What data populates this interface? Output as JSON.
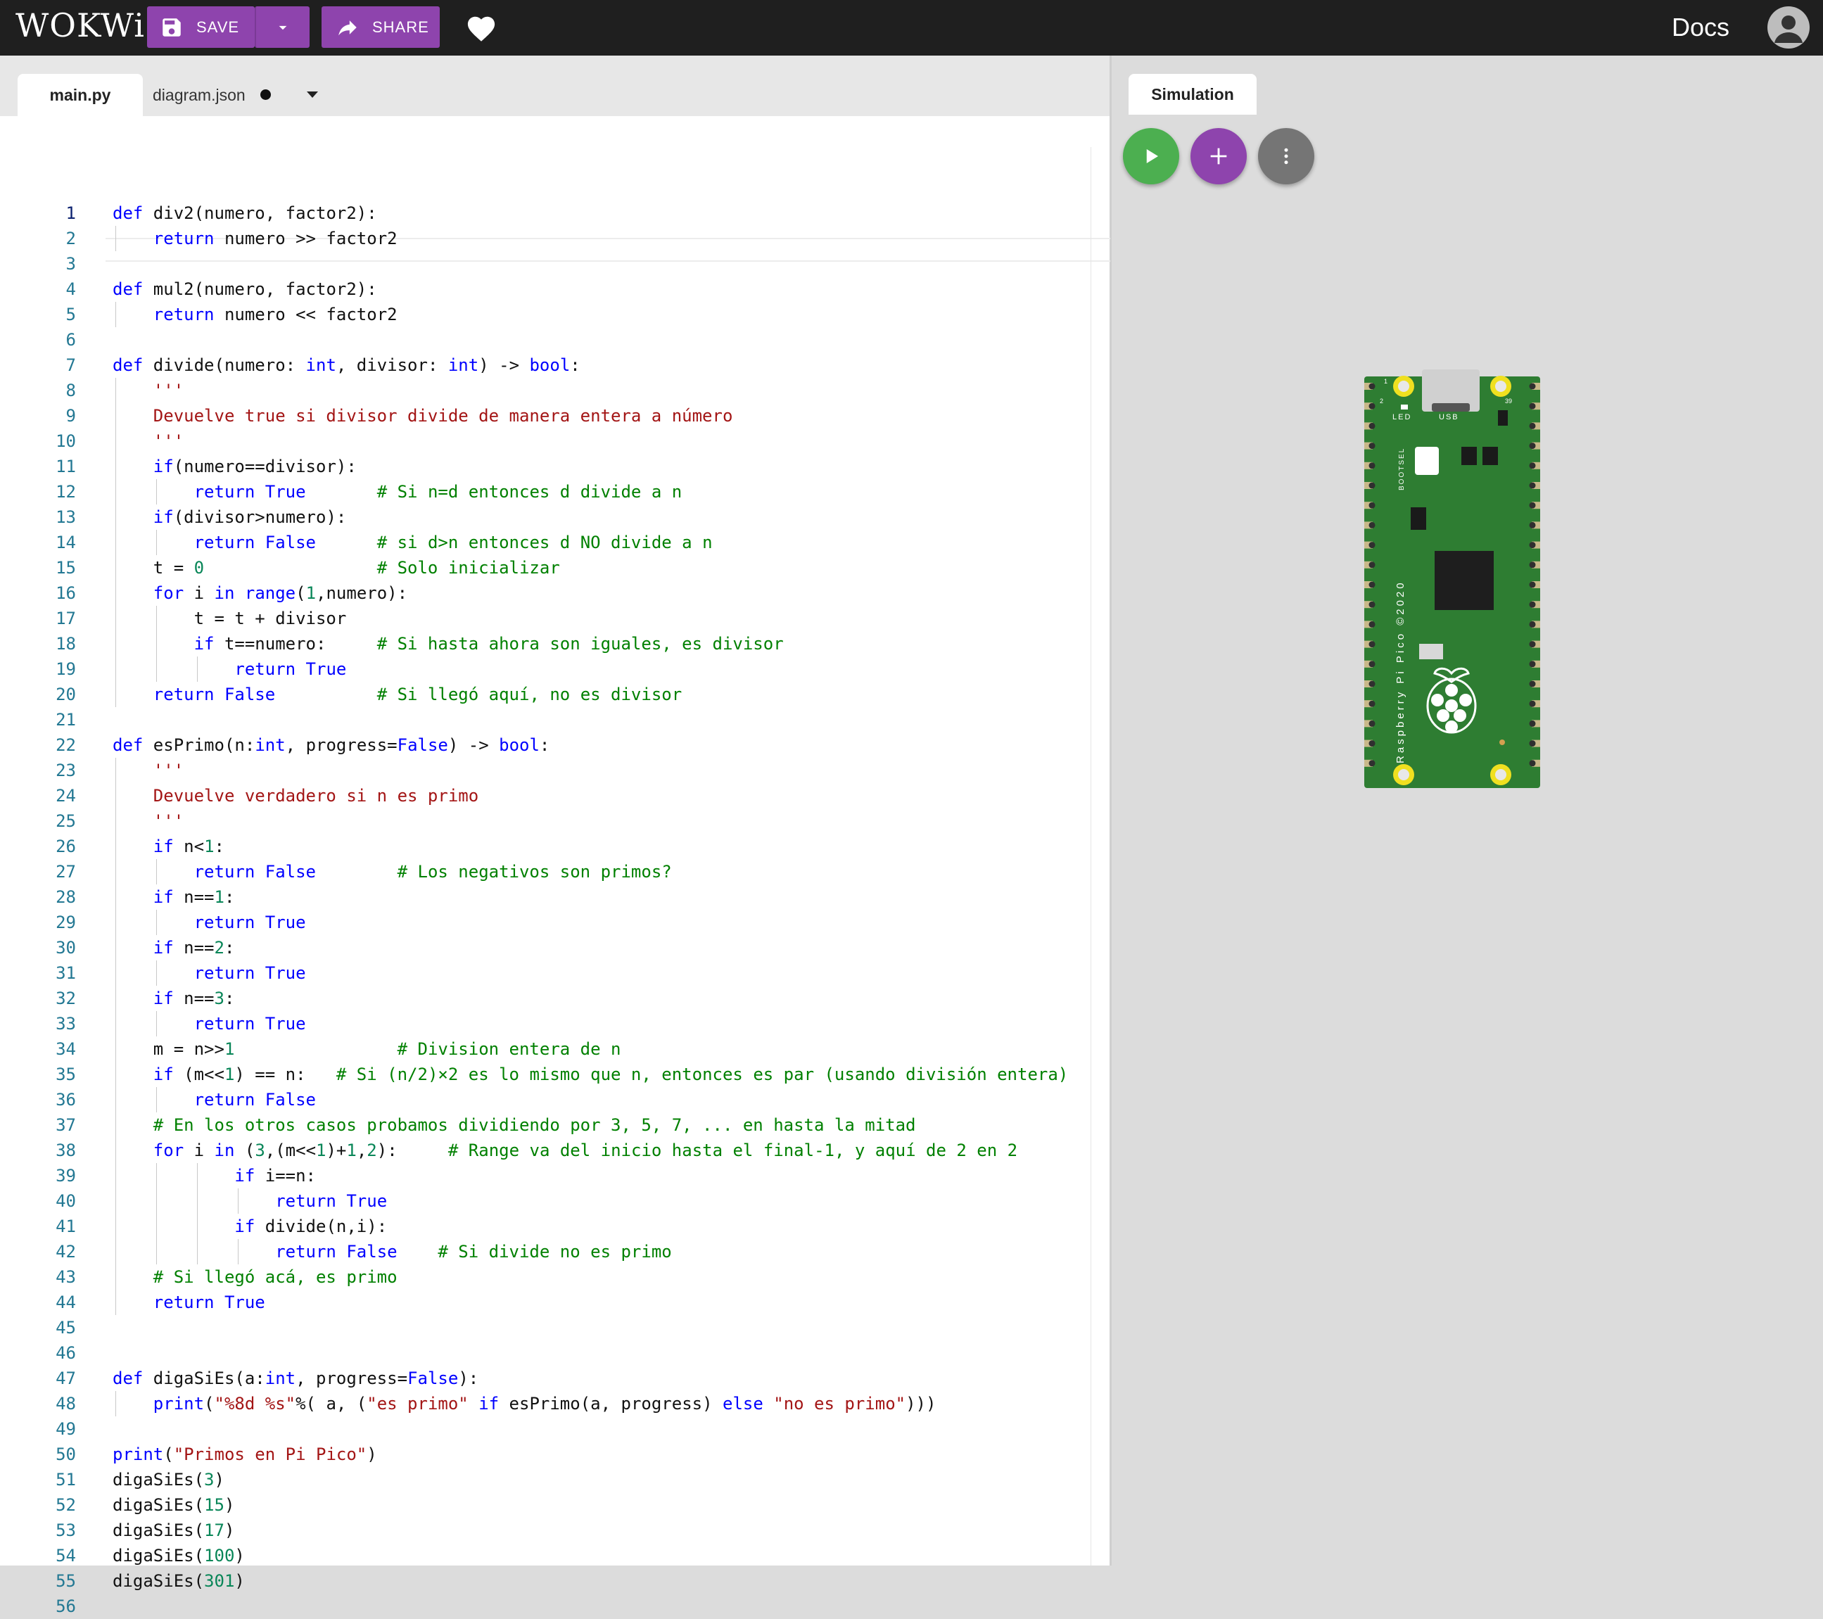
{
  "header": {
    "logo": "WOKWi",
    "save_label": "SAVE",
    "share_label": "SHARE",
    "docs_label": "Docs",
    "icons": [
      "save-icon",
      "chevron-down-icon",
      "share-icon",
      "heart-icon",
      "avatar-icon"
    ]
  },
  "editor": {
    "tabs": [
      {
        "label": "main.py",
        "active": true
      },
      {
        "label": "diagram.json",
        "modified": true
      }
    ]
  },
  "code": [
    "def div2(numero, factor2):",
    "    return numero >> factor2",
    "",
    "def mul2(numero, factor2):",
    "    return numero << factor2",
    "",
    "def divide(numero: int, divisor: int) -> bool:",
    "    '''",
    "    Devuelve true si divisor divide de manera entera a número",
    "    '''",
    "    if(numero==divisor):",
    "        return True       # Si n=d entonces d divide a n",
    "    if(divisor>numero):",
    "        return False      # si d>n entonces d NO divide a n",
    "    t = 0                 # Solo inicializar",
    "    for i in range(1,numero):",
    "        t = t + divisor",
    "        if t==numero:     # Si hasta ahora son iguales, es divisor",
    "            return True",
    "    return False          # Si llegó aquí, no es divisor",
    "",
    "def esPrimo(n:int, progress=False) -> bool:",
    "    '''",
    "    Devuelve verdadero si n es primo",
    "    '''",
    "    if n<1:",
    "        return False        # Los negativos son primos?",
    "    if n==1:",
    "        return True",
    "    if n==2:",
    "        return True",
    "    if n==3:",
    "        return True",
    "    m = n>>1                # Division entera de n",
    "    if (m<<1) == n:   # Si (n/2)×2 es lo mismo que n, entonces es par (usando división entera)",
    "        return False",
    "    # En los otros casos probamos dividiendo por 3, 5, 7, ... en hasta la mitad",
    "    for i in (3,(m<<1)+1,2):     # Range va del inicio hasta el final-1, y aquí de 2 en 2",
    "            if i==n:",
    "                return True",
    "            if divide(n,i):",
    "                return False    # Si divide no es primo",
    "    # Si llegó acá, es primo",
    "    return True",
    "",
    "",
    "def digaSiEs(a:int, progress=False):",
    "    print(\"%8d %s\"%( a, (\"es primo\" if esPrimo(a, progress) else \"no es primo\")))",
    "",
    "print(\"Primos en Pi Pico\")",
    "digaSiEs(3)",
    "digaSiEs(15)",
    "digaSiEs(17)",
    "digaSiEs(100)",
    "digaSiEs(301)",
    ""
  ],
  "simulation": {
    "tab_label": "Simulation",
    "buttons": [
      "play-icon",
      "plus-icon",
      "more-vert-icon"
    ],
    "board": {
      "label": "Raspberry Pi Pico ©2020",
      "led_label": "LED",
      "usb_label": "USB",
      "bootsel_label": "BOOTSEL",
      "pin_first": "1",
      "pin_second": "2",
      "pin_last": "39"
    }
  },
  "colors": {
    "topbar": "#1f1f1f",
    "accent_purple": "#8e44ad",
    "run_green": "#4caf50",
    "board_green": "#2e7d32",
    "keyword": "#0000ff",
    "string": "#a31515",
    "comment": "#008000",
    "number": "#098658",
    "line_number": "#237893"
  }
}
